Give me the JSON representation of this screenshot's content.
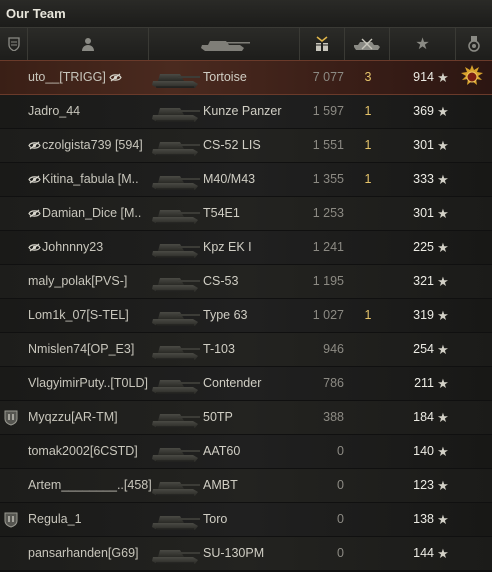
{
  "title": "Our Team",
  "header": {
    "columns": [
      {
        "icon": "badge-column-icon"
      },
      {
        "icon": "player-column-icon"
      },
      {
        "icon": "vehicle-column-icon"
      },
      {
        "icon": "damage-column-icon"
      },
      {
        "icon": "frags-column-icon"
      },
      {
        "icon": "star-column-icon"
      },
      {
        "icon": "medal-column-icon"
      }
    ]
  },
  "rows": [
    {
      "name": "uto__[TRIGG]",
      "eye": "after",
      "tank": "Tortoise",
      "damage": "7 077",
      "frags": "3",
      "score": "914",
      "star": "★",
      "medal": true,
      "player": true,
      "badge": false
    },
    {
      "name": "Jadro_44",
      "eye": "none",
      "tank": "Kunze Panzer",
      "damage": "1 597",
      "frags": "1",
      "score": "369",
      "star": "★",
      "medal": false,
      "player": false,
      "badge": false
    },
    {
      "name": "czolgista739 [594]",
      "eye": "before",
      "tank": "CS-52 LIS",
      "damage": "1 551",
      "frags": "1",
      "score": "301",
      "star": "★",
      "medal": false,
      "player": false,
      "badge": false
    },
    {
      "name": "Kitina_fabula [M..",
      "eye": "before",
      "tank": "M40/M43",
      "damage": "1 355",
      "frags": "1",
      "score": "333",
      "star": "★",
      "medal": false,
      "player": false,
      "badge": false
    },
    {
      "name": "Damian_Dice [M..",
      "eye": "before",
      "tank": "T54E1",
      "damage": "1 253",
      "frags": "",
      "score": "301",
      "star": "★",
      "medal": false,
      "player": false,
      "badge": false
    },
    {
      "name": "Johnnny23",
      "eye": "before",
      "tank": "Kpz EK I",
      "damage": "1 241",
      "frags": "",
      "score": "225",
      "star": "★",
      "medal": false,
      "player": false,
      "badge": false
    },
    {
      "name": "maly_polak[PVS-]",
      "eye": "none",
      "tank": "CS-53",
      "damage": "1 195",
      "frags": "",
      "score": "321",
      "star": "★",
      "medal": false,
      "player": false,
      "badge": false
    },
    {
      "name": "Lom1k_07[S-TEL]",
      "eye": "none",
      "tank": "Type 63",
      "damage": "1 027",
      "frags": "1",
      "score": "319",
      "star": "★",
      "medal": false,
      "player": false,
      "badge": false
    },
    {
      "name": "Nmislen74[OP_E3]",
      "eye": "none",
      "tank": "T-103",
      "damage": "946",
      "frags": "",
      "score": "254",
      "star": "★",
      "medal": false,
      "player": false,
      "badge": false
    },
    {
      "name": "VlagyimirPuty..[T0LD]",
      "eye": "none",
      "tank": "Contender",
      "damage": "786",
      "frags": "",
      "score": "211",
      "star": "★",
      "medal": false,
      "player": false,
      "badge": false
    },
    {
      "name": "Myqzzu[AR-TM]",
      "eye": "none",
      "tank": "50TP",
      "damage": "388",
      "frags": "",
      "score": "184",
      "star": "★",
      "medal": false,
      "player": false,
      "badge": true
    },
    {
      "name": "tomak2002[6CSTD]",
      "eye": "none",
      "tank": "AAT60",
      "damage": "0",
      "frags": "",
      "score": "140",
      "star": "★",
      "medal": false,
      "player": false,
      "badge": false
    },
    {
      "name": "Artem________..[458]",
      "eye": "none",
      "tank": "AMBT",
      "damage": "0",
      "frags": "",
      "score": "123",
      "star": "★",
      "medal": false,
      "player": false,
      "badge": false
    },
    {
      "name": "Regula_1",
      "eye": "none",
      "tank": "Toro",
      "damage": "0",
      "frags": "",
      "score": "138",
      "star": "★",
      "medal": false,
      "player": false,
      "badge": true
    },
    {
      "name": "pansarhanden[G69]",
      "eye": "none",
      "tank": "SU-130PM",
      "damage": "0",
      "frags": "",
      "score": "144",
      "star": "★",
      "medal": false,
      "player": false,
      "badge": false
    }
  ],
  "colors": {
    "player_row": "#4a2a1f",
    "frags": "#e4c36a",
    "accent_gold": "#d9a32c"
  }
}
